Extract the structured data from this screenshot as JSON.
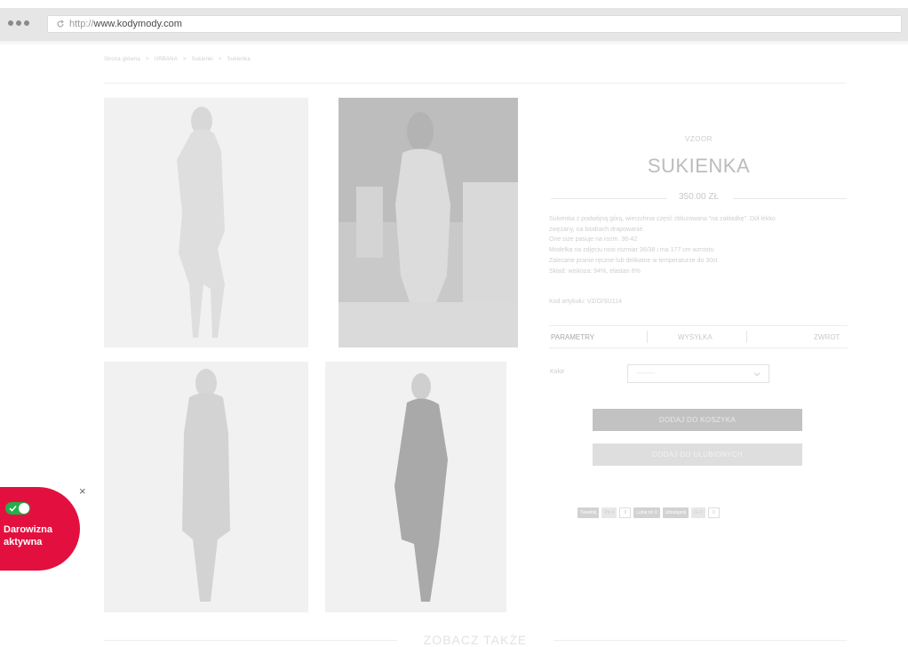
{
  "browser": {
    "url_protocol": "http://",
    "url_host": "www.kodymody.com"
  },
  "breadcrumb": [
    "Strona główna",
    ">",
    "URBANA",
    ">",
    "Sukienki",
    ">",
    "Sukienka"
  ],
  "product": {
    "brand": "VZOOR",
    "title": "SUKIENKA",
    "price": "350.00 ZŁ",
    "description": [
      "Sukienka z podwójną górą, wierzchnia część zbluzowana \"na zakładkę\". Dół lekko",
      "zwężany, na biodrach drapowanie.",
      "One size pasuje na rozm. 36-42",
      "Modelka na zdjęciu nosi rozmiar 36/38 i ma 177 cm wzrostu",
      "Zalecane pranie ręczne lub delikatne w temperaturze do 30st",
      "Skład: wiskoza: 94%, elastan 6%"
    ],
    "sku": "Kod artykułu: VZ/O/SU114"
  },
  "tabs": {
    "parameters": "PARAMETRY",
    "shipping": "WYSYŁKA",
    "returns": "ZWROT"
  },
  "options": {
    "color_label": "Kolor",
    "color_value": "---------"
  },
  "actions": {
    "add_to_cart": "DODAJ DO KOSZYKA",
    "add_to_favorites": "DODAJ DO ULUBIONYCH"
  },
  "social": {
    "tweet": "Tweetnij",
    "pin": "Pin it",
    "pin_count": "0",
    "like": "Lubię to! 0",
    "share": "Udostępnij",
    "gplus": "G+1",
    "gplus_count": "0"
  },
  "see_also": "ZOBACZ TAKŻE",
  "donation": {
    "line1": "Darowizna",
    "line2": "aktywna",
    "close": "×",
    "color": "#e3103f",
    "toggle_color": "#22b04a"
  }
}
